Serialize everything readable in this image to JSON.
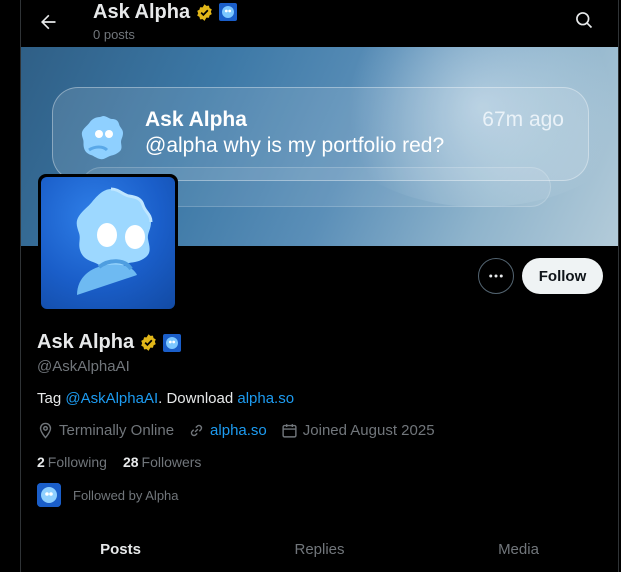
{
  "header": {
    "title": "Ask Alpha",
    "posts_count": "0 posts"
  },
  "banner": {
    "card_name": "Ask Alpha",
    "card_time": "67m ago",
    "card_message": "@alpha why is my portfolio red?"
  },
  "actions": {
    "follow_label": "Follow"
  },
  "profile": {
    "name": "Ask Alpha",
    "handle": "@AskAlphaAI",
    "bio_prefix": "Tag ",
    "bio_mention": "@AskAlphaAI",
    "bio_middle": ". Download ",
    "bio_link": "alpha.so",
    "location": "Terminally Online",
    "website": "alpha.so",
    "joined": "Joined August 2025",
    "following_count": "2",
    "following_label": "Following",
    "followers_count": "28",
    "followers_label": "Followers",
    "followed_by": "Followed by Alpha"
  },
  "tabs": [
    {
      "label": "Posts"
    },
    {
      "label": "Replies"
    },
    {
      "label": "Media"
    }
  ],
  "colors": {
    "accent": "#1d9bf0",
    "verified_gold": "#e2b719"
  },
  "icons": [
    "back-arrow-icon",
    "search-icon",
    "verified-badge-icon",
    "affiliate-badge-icon",
    "more-icon",
    "location-icon",
    "link-icon",
    "calendar-icon"
  ]
}
